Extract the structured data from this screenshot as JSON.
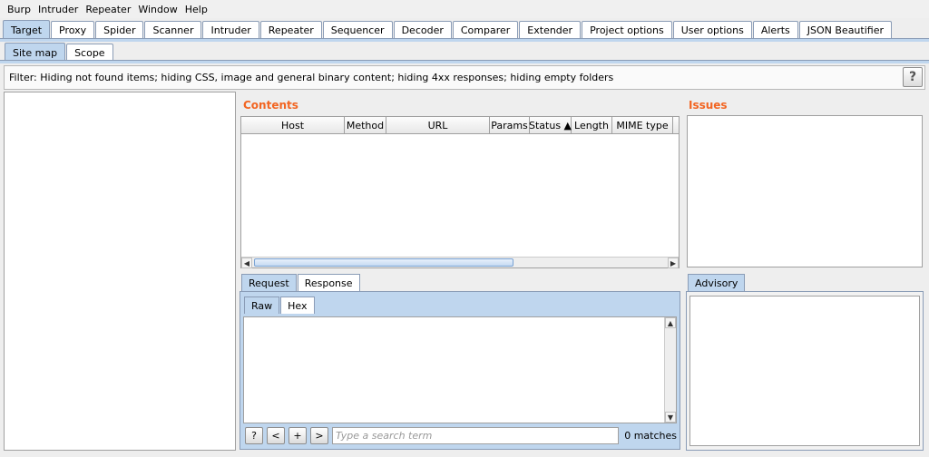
{
  "menu": [
    "Burp",
    "Intruder",
    "Repeater",
    "Window",
    "Help"
  ],
  "main_tabs": [
    "Target",
    "Proxy",
    "Spider",
    "Scanner",
    "Intruder",
    "Repeater",
    "Sequencer",
    "Decoder",
    "Comparer",
    "Extender",
    "Project options",
    "User options",
    "Alerts",
    "JSON Beautifier"
  ],
  "sub_tabs": [
    "Site map",
    "Scope"
  ],
  "filter_text": "Filter: Hiding not found items;  hiding CSS, image and general binary content;  hiding 4xx responses;  hiding empty folders",
  "help_label": "?",
  "contents": {
    "title": "Contents",
    "columns": [
      "Host",
      "Method",
      "URL",
      "Params",
      "Status ▲",
      "Length",
      "MIME type"
    ]
  },
  "issues_title": "Issues",
  "reqresp_tabs": [
    "Request",
    "Response"
  ],
  "view_tabs": [
    "Raw",
    "Hex"
  ],
  "advisory_tab": "Advisory",
  "search": {
    "buttons": [
      "?",
      "<",
      "+",
      ">"
    ],
    "placeholder": "Type a search term",
    "matches": "0 matches"
  },
  "colors": {
    "accent": "#f26522",
    "tab_active": "#bfd6ee"
  }
}
